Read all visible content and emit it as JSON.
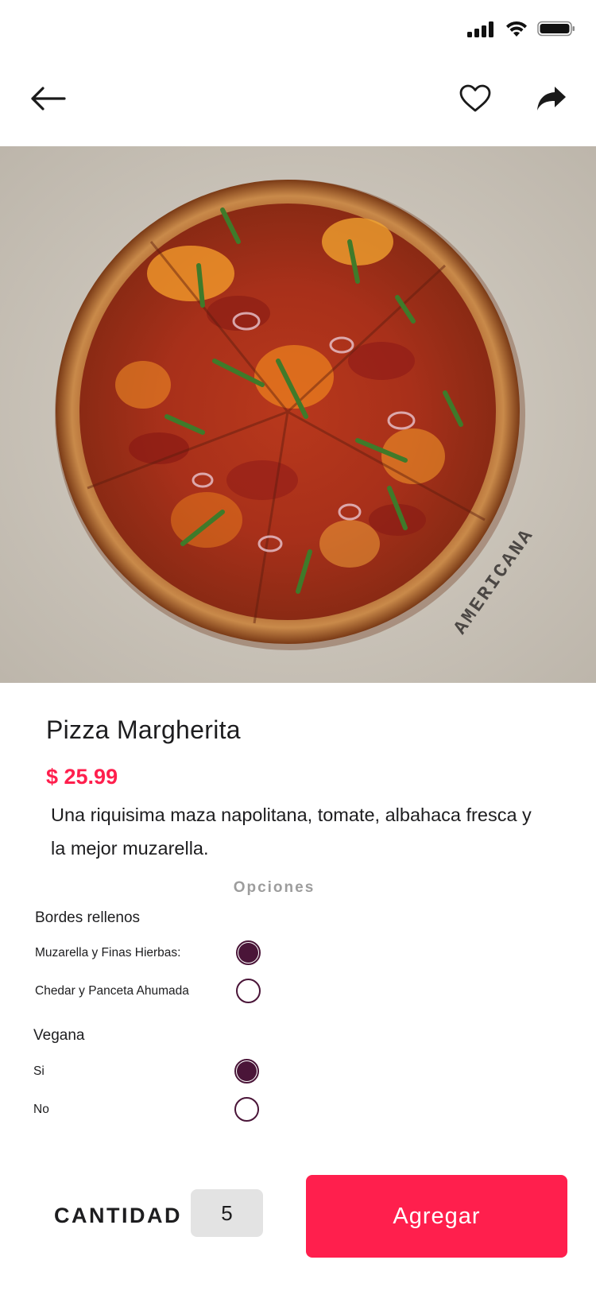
{
  "colors": {
    "accent": "#ff1f4d",
    "radio": "#4a1538",
    "muted": "#9d9d9d",
    "qty_bg": "#e3e3e3"
  },
  "icons": {
    "back": "arrow-left-icon",
    "favorite": "heart-icon",
    "share": "share-arrow-icon",
    "signal": "signal-icon",
    "wifi": "wifi-icon",
    "battery": "battery-icon"
  },
  "product": {
    "image_stamp": "AMERICANA",
    "title": "Pizza Margherita",
    "price": "$ 25.99",
    "description": "Una riquisima maza napolitana, tomate, albahaca fresca y la mejor muzarella."
  },
  "options": {
    "header": "Opciones",
    "groups": [
      {
        "title": "Bordes rellenos",
        "items": [
          {
            "label": "Muzarella y Finas Hierbas:",
            "selected": true
          },
          {
            "label": "Chedar y Panceta Ahumada",
            "selected": false
          }
        ]
      },
      {
        "title": "Vegana",
        "items": [
          {
            "label": "Si",
            "selected": true
          },
          {
            "label": "No",
            "selected": false
          }
        ]
      }
    ]
  },
  "footer": {
    "quantity_label": "CANTIDAD",
    "quantity_value": "5",
    "add_label": "Agregar"
  }
}
